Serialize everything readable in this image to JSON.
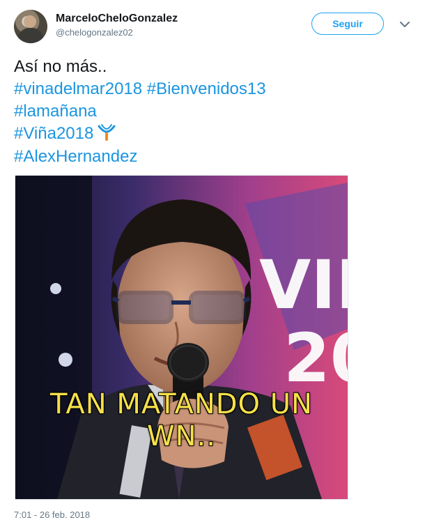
{
  "user": {
    "display_name": "MarceloCheloGonzalez",
    "handle": "@chelogonzalez02",
    "follow_label": "Seguir"
  },
  "tweet": {
    "text_line1": "Así no más..",
    "hashtag_vinadelmar": "#vinadelmar2018",
    "hashtag_bienvenidos": "#Bienvenidos13",
    "hashtag_lamanana": "#lamañana",
    "hashtag_vina": "#Viña2018",
    "hashtag_alex": "#AlexHernandez",
    "emoji": "vina-festival-logo-icon"
  },
  "media": {
    "caption": "TAN MATANDO UN WN.."
  },
  "footer": {
    "timestamp": "7:01 - 26 feb. 2018"
  },
  "colors": {
    "hashtag": "#1b95e0",
    "follow_accent": "#1da1f2",
    "secondary_text": "#657786",
    "caption_yellow": "#f5e04a"
  }
}
